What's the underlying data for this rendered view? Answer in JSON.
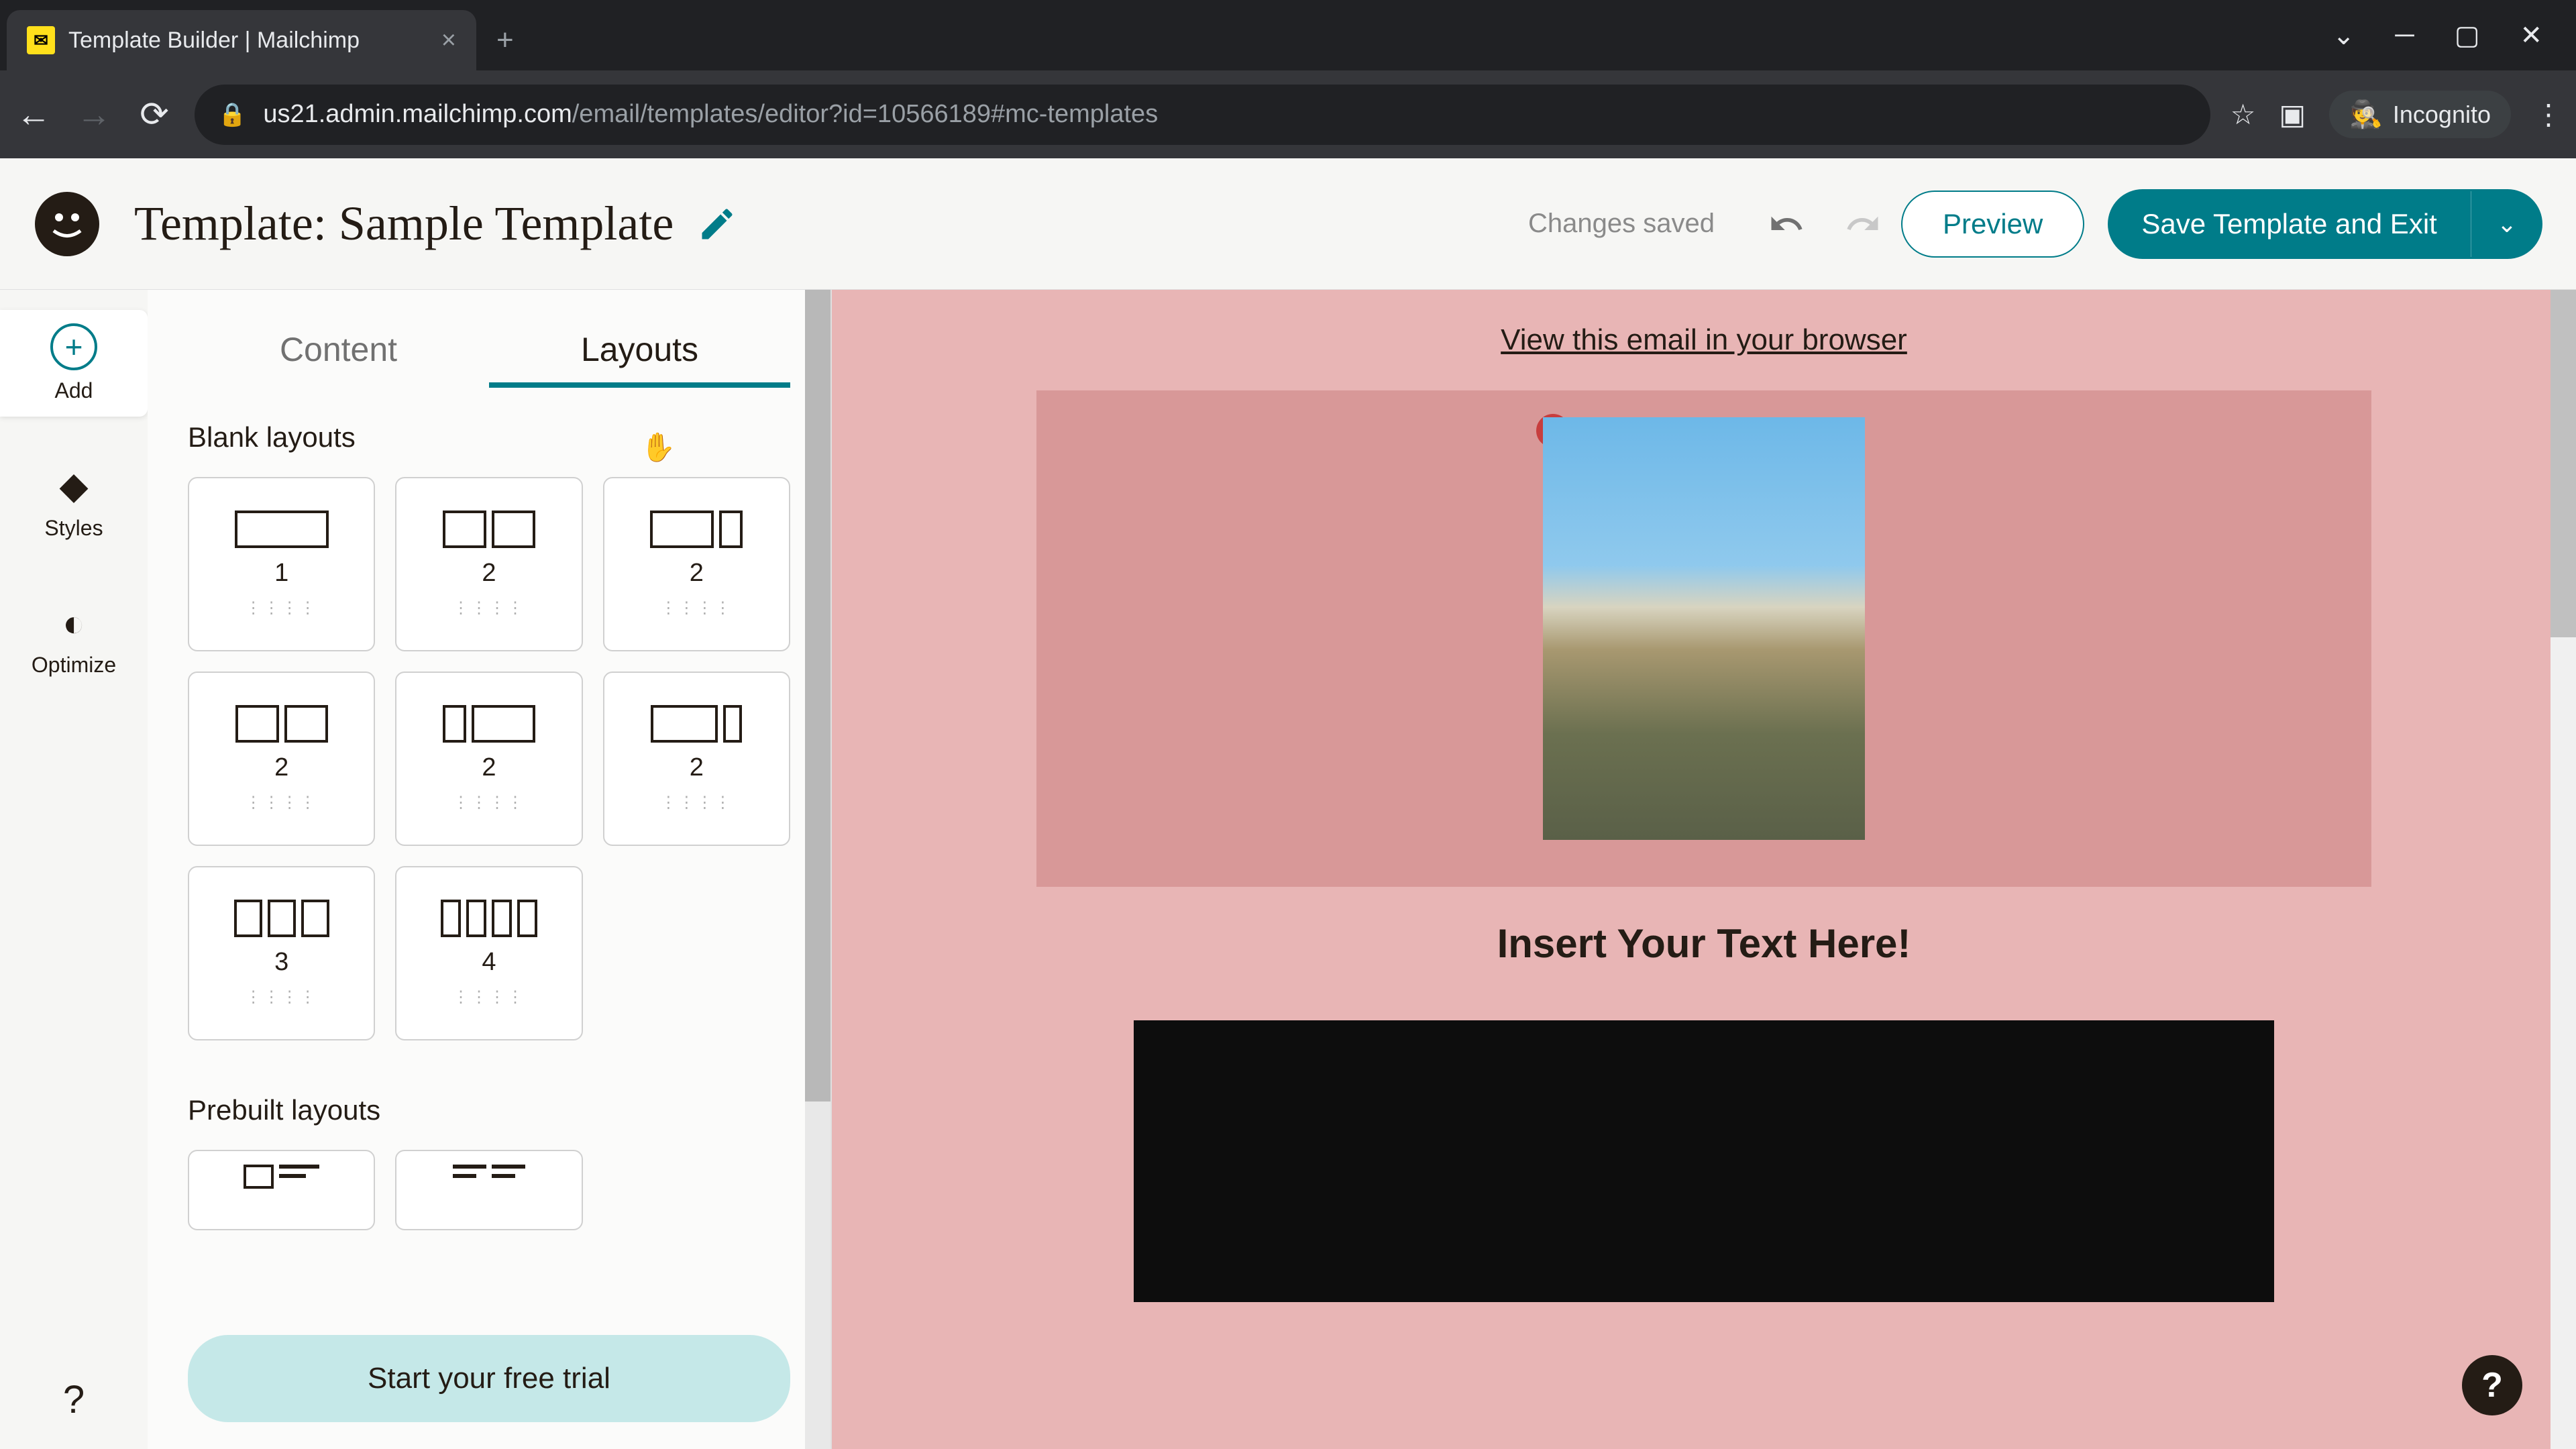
{
  "browser": {
    "tab_title": "Template Builder | Mailchimp",
    "url_host": "us21.admin.mailchimp.com",
    "url_path": "/email/templates/editor?id=10566189#mc-templates",
    "incognito_label": "Incognito"
  },
  "header": {
    "title": "Template: Sample Template",
    "status": "Changes saved",
    "preview_label": "Preview",
    "save_label": "Save Template and Exit"
  },
  "side_rail": {
    "items": [
      {
        "label": "Add",
        "icon": "plus"
      },
      {
        "label": "Styles",
        "icon": "diamond"
      },
      {
        "label": "Optimize",
        "icon": "gauge"
      }
    ]
  },
  "panel": {
    "tabs": [
      {
        "label": "Content",
        "active": false
      },
      {
        "label": "Layouts",
        "active": true
      }
    ],
    "blank_section_label": "Blank layouts",
    "prebuilt_section_label": "Prebuilt layouts",
    "blank_layouts": [
      {
        "cols": "1",
        "widths": [
          120
        ]
      },
      {
        "cols": "2",
        "widths": [
          60,
          60
        ]
      },
      {
        "cols": "2",
        "widths": [
          90,
          30
        ]
      },
      {
        "cols": "2",
        "widths": [
          60,
          60
        ]
      },
      {
        "cols": "2",
        "widths": [
          30,
          90
        ]
      },
      {
        "cols": "2",
        "widths": [
          95,
          25
        ]
      },
      {
        "cols": "3",
        "widths": [
          40,
          40,
          40
        ]
      },
      {
        "cols": "4",
        "widths": [
          30,
          30,
          30,
          30
        ]
      }
    ],
    "trial_cta": "Start your free trial"
  },
  "canvas": {
    "browser_link": "View this email in your browser",
    "heading": "Insert Your Text Here!"
  }
}
